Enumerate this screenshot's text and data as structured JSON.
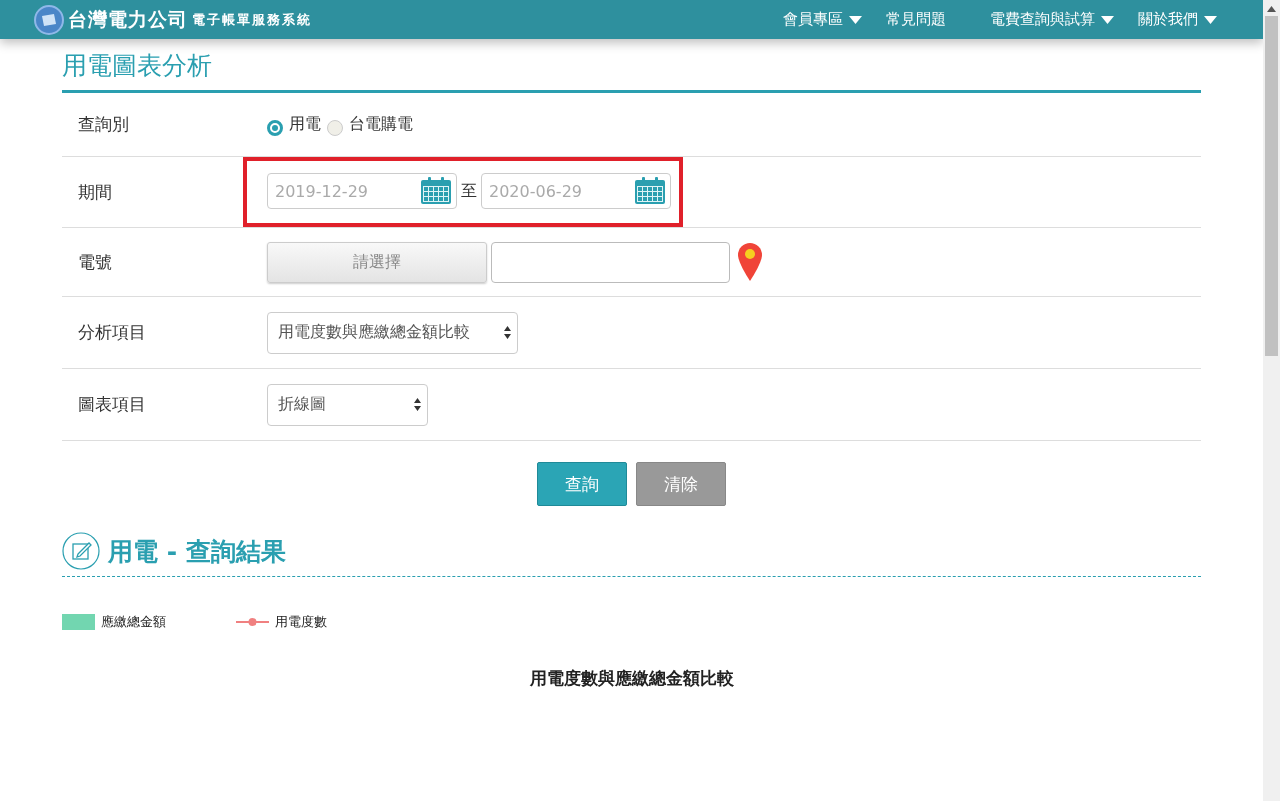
{
  "header": {
    "logo_text": "台灣電力公司",
    "subtitle": "電子帳單服務系統",
    "nav": [
      {
        "label": "會員專區",
        "dropdown": true
      },
      {
        "label": "常見問題",
        "dropdown": false
      },
      {
        "label": "電費查詢與試算",
        "dropdown": true
      },
      {
        "label": "關於我們",
        "dropdown": true
      }
    ]
  },
  "page_title": "用電圖表分析",
  "form": {
    "rows": [
      {
        "kind": "radio",
        "label": "查詢別",
        "options": [
          {
            "label": "用電",
            "selected": true
          },
          {
            "label": "台電購電",
            "selected": false
          }
        ]
      },
      {
        "kind": "daterange",
        "label": "期間",
        "highlighted": true,
        "from": {
          "placeholder": "2019-12-29"
        },
        "separator": "至",
        "to": {
          "placeholder": "2020-06-29"
        }
      },
      {
        "kind": "picker",
        "label": "電號",
        "button": "請選擇"
      },
      {
        "kind": "select",
        "label": "分析項目",
        "value": "用電度數與應繳總金額比較"
      },
      {
        "kind": "select",
        "label": "圖表項目",
        "value": "折線圖"
      }
    ]
  },
  "actions": [
    {
      "label": "查詢",
      "primary": true
    },
    {
      "label": "清除",
      "primary": false
    }
  ],
  "results": {
    "title": "用電 - 查詢結果",
    "legend": [
      {
        "kind": "bar",
        "label": "應繳總金額",
        "color": "#72d6b0"
      },
      {
        "kind": "line",
        "label": "用電度數",
        "color": "#f08080"
      }
    ],
    "chart_title": "用電度數與應繳總金額比較"
  }
}
